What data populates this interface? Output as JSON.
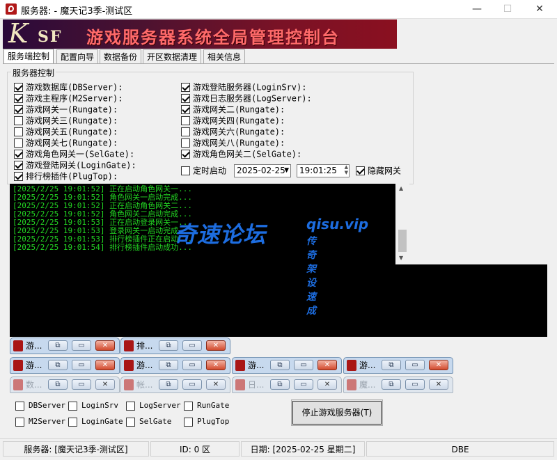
{
  "window": {
    "title": "服务器: - 魔天记3季-测试区",
    "controls": {
      "minimize": "—",
      "maximize": "☐",
      "close": "✕"
    }
  },
  "banner": {
    "logo_k": "K",
    "logo_sf": "SF",
    "text": "游戏服务器系统全局管理控制台"
  },
  "tabs": [
    {
      "label": "服务端控制",
      "active": true
    },
    {
      "label": "配置向导"
    },
    {
      "label": "数据备份"
    },
    {
      "label": "开区数据清理"
    },
    {
      "label": "相关信息"
    }
  ],
  "group": {
    "label": "服务器控制",
    "left_column": [
      {
        "label": "游戏数据库(DBServer):",
        "checked": true
      },
      {
        "label": "游戏主程序(M2Server):",
        "checked": true
      },
      {
        "label": "游戏网关一(Rungate):",
        "checked": true
      },
      {
        "label": "游戏网关三(Rungate):",
        "checked": false
      },
      {
        "label": "游戏网关五(Rungate):",
        "checked": false
      },
      {
        "label": "游戏网关七(Rungate):",
        "checked": false
      },
      {
        "label": "游戏角色网关一(SelGate):",
        "checked": true
      },
      {
        "label": "游戏登陆网关(LoginGate):",
        "checked": true
      },
      {
        "label": "排行榜插件(PlugTop):",
        "checked": true
      }
    ],
    "right_column": [
      {
        "label": "游戏登陆服务器(LoginSrv):",
        "checked": true
      },
      {
        "label": "游戏日志服务器(LogServer):",
        "checked": true
      },
      {
        "label": "游戏网关二(Rungate):",
        "checked": true
      },
      {
        "label": "游戏网关四(Rungate):",
        "checked": false
      },
      {
        "label": "游戏网关六(Rungate):",
        "checked": false
      },
      {
        "label": "游戏网关八(Rungate):",
        "checked": false
      },
      {
        "label": "游戏角色网关二(SelGate):",
        "checked": true
      }
    ],
    "schedule": {
      "label": "定时启动",
      "checked": false,
      "date": "2025-02-25",
      "time": "19:01:25"
    },
    "hide_gateway": {
      "label": "隐藏网关",
      "checked": true
    }
  },
  "log": [
    "[2025/2/25 19:01:52] 正在启动角色网关一...",
    "[2025/2/25 19:01:52] 角色网关一启动完成...",
    "[2025/2/25 19:01:52] 正在启动角色网关二...",
    "[2025/2/25 19:01:52] 角色网关二启动完成...",
    "[2025/2/25 19:01:53] 正在启动登录网关一...",
    "[2025/2/25 19:01:53] 登录网关一启动完成...",
    "[2025/2/25 19:01:53] 排行榜插件正在启动...",
    "[2025/2/25 19:01:54] 排行榜插件启动成功..."
  ],
  "watermark": {
    "big": "奇速论坛",
    "url": "qisu.vip",
    "sub": "传奇架设速成"
  },
  "mini_windows": [
    {
      "title": "游...",
      "dim": false
    },
    {
      "title": "排...",
      "dim": false
    },
    {
      "title": "游...",
      "dim": false
    },
    {
      "title": "游...",
      "dim": false
    },
    {
      "title": "游...",
      "dim": false
    },
    {
      "title": "游...",
      "dim": false
    },
    {
      "title": "数...",
      "dim": true
    },
    {
      "title": "帐...",
      "dim": true
    },
    {
      "title": "日...",
      "dim": true
    },
    {
      "title": "魔...",
      "dim": true
    }
  ],
  "bottom_checks": [
    {
      "label": "DBServer",
      "checked": false
    },
    {
      "label": "LoginSrv",
      "checked": false
    },
    {
      "label": "LogServer",
      "checked": false
    },
    {
      "label": "RunGate",
      "checked": false
    },
    {
      "label": "M2Server",
      "checked": false
    },
    {
      "label": "LoginGate",
      "checked": false
    },
    {
      "label": "SelGate",
      "checked": false
    },
    {
      "label": "PlugTop",
      "checked": false
    }
  ],
  "stop_button": "停止游戏服务器(T)",
  "status": {
    "server": "服务器:   [魔天记3季-测试区]",
    "id": "ID: 0 区",
    "date": "日期:   [2025-02-25 星期二]",
    "extra": "DBE"
  }
}
